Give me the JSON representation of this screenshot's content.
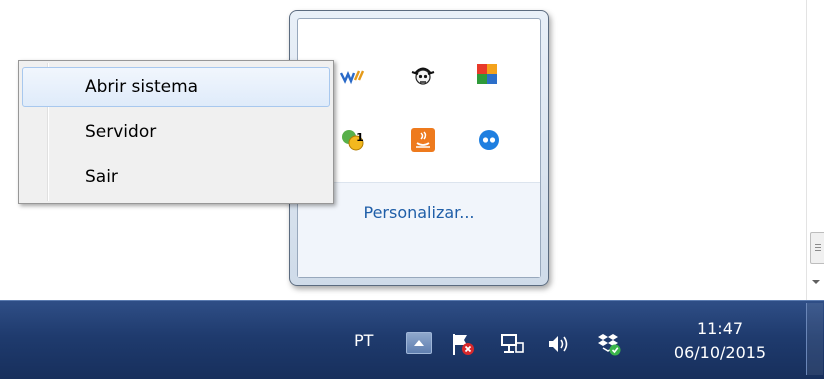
{
  "context_menu": {
    "items": [
      {
        "label": "Abrir sistema",
        "hovered": true
      },
      {
        "label": "Servidor",
        "hovered": false
      },
      {
        "label": "Sair",
        "hovered": false
      }
    ]
  },
  "flyout": {
    "icons": [
      "veetle-tv-icon",
      "pirate-skull-icon",
      "avg-antivirus-icon",
      "update-notifier-icon",
      "java-update-icon",
      "blue-dots-app-icon"
    ],
    "notification_badge": "1",
    "customize_label": "Personalizar..."
  },
  "taskbar": {
    "language": "PT",
    "tray_icons": [
      "action-center-flag-icon",
      "network-icon",
      "volume-icon",
      "dropbox-icon"
    ],
    "clock": {
      "time": "11:47",
      "date": "06/10/2015"
    }
  },
  "colors": {
    "taskbar": "#1f3b6e",
    "menu_background": "#f0f0f0",
    "menu_hover_border": "#a8c8ee",
    "link": "#1f5ea8"
  }
}
